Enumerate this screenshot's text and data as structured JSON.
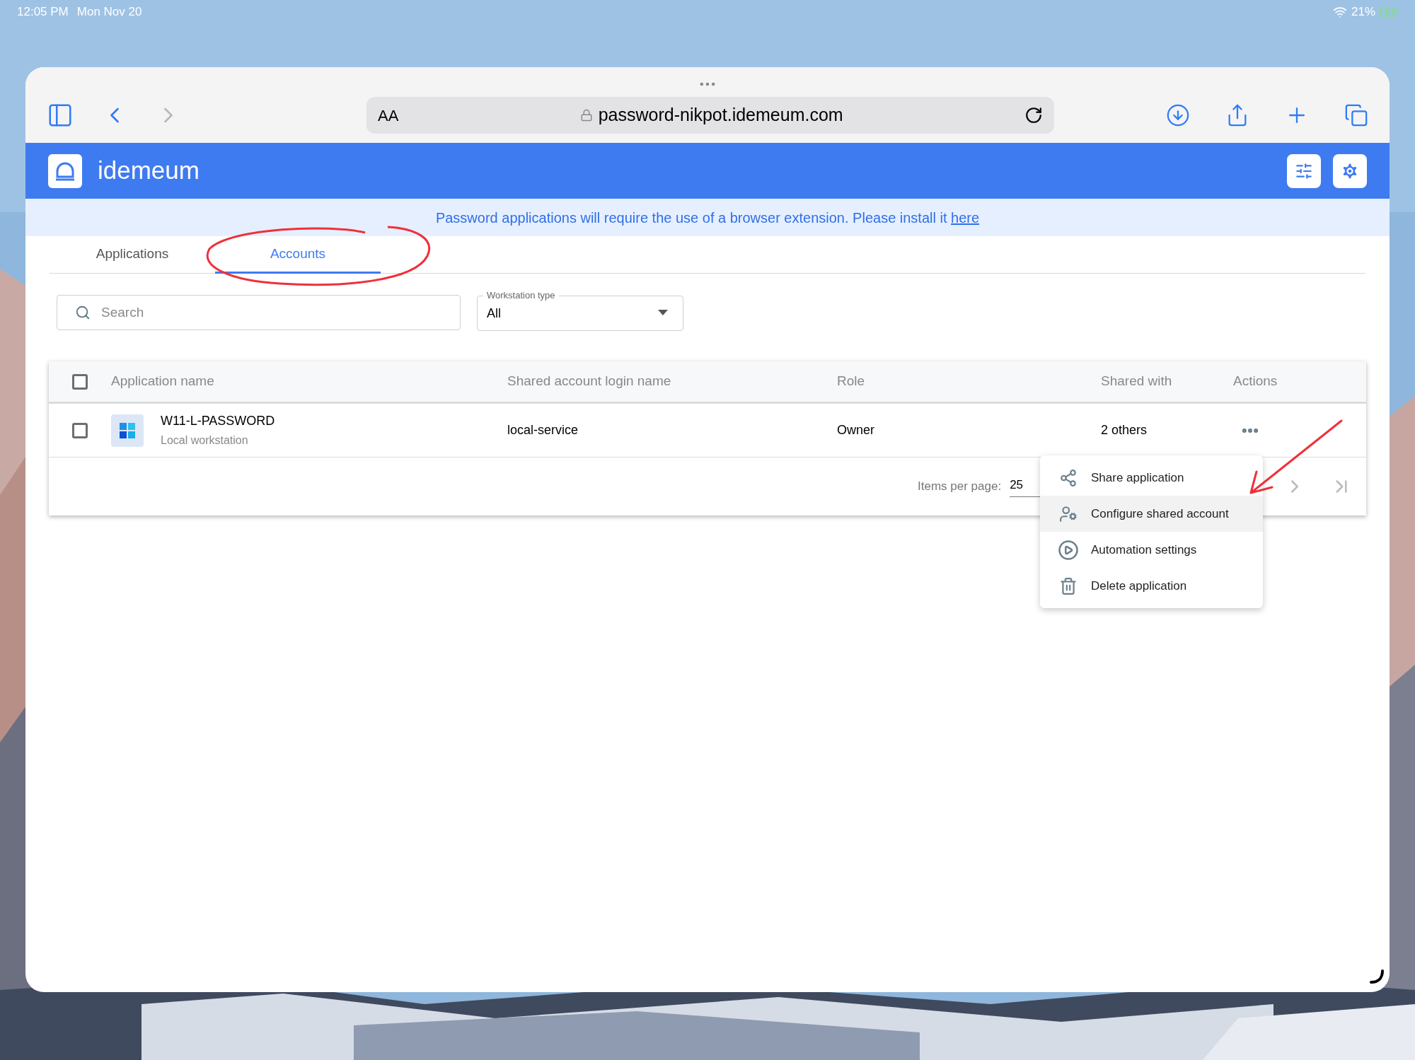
{
  "status_bar": {
    "time": "12:05 PM",
    "date": "Mon Nov 20",
    "battery": "21%"
  },
  "browser": {
    "text_size_button": "AA",
    "url": "password-nikpot.idemeum.com"
  },
  "app": {
    "name": "idemeum"
  },
  "banner": {
    "text": "Password applications will require the use of a browser extension. Please install it",
    "link": "here"
  },
  "tabs": [
    {
      "label": "Applications",
      "selected": false
    },
    {
      "label": "Accounts",
      "selected": true
    }
  ],
  "search": {
    "placeholder": "Search"
  },
  "workstation_filter": {
    "label": "Workstation type",
    "value": "All"
  },
  "table": {
    "select_all_checked": false,
    "columns": [
      "Application name",
      "Shared account login name",
      "Role",
      "Shared with",
      "Actions"
    ],
    "rows": [
      {
        "checked": false,
        "name": "W11-L-PASSWORD",
        "subtitle": "Local workstation",
        "login": "local-service",
        "role": "Owner",
        "shared_with": "2 others"
      }
    ]
  },
  "pagination": {
    "label": "Items per page:",
    "page_size": "25"
  },
  "actions_menu": [
    {
      "label": "Share application",
      "kind": "share",
      "selected": false
    },
    {
      "label": "Configure shared account",
      "kind": "configure",
      "selected": true
    },
    {
      "label": "Automation settings",
      "kind": "automation",
      "selected": false
    },
    {
      "label": "Delete application",
      "kind": "delete",
      "selected": false
    }
  ]
}
